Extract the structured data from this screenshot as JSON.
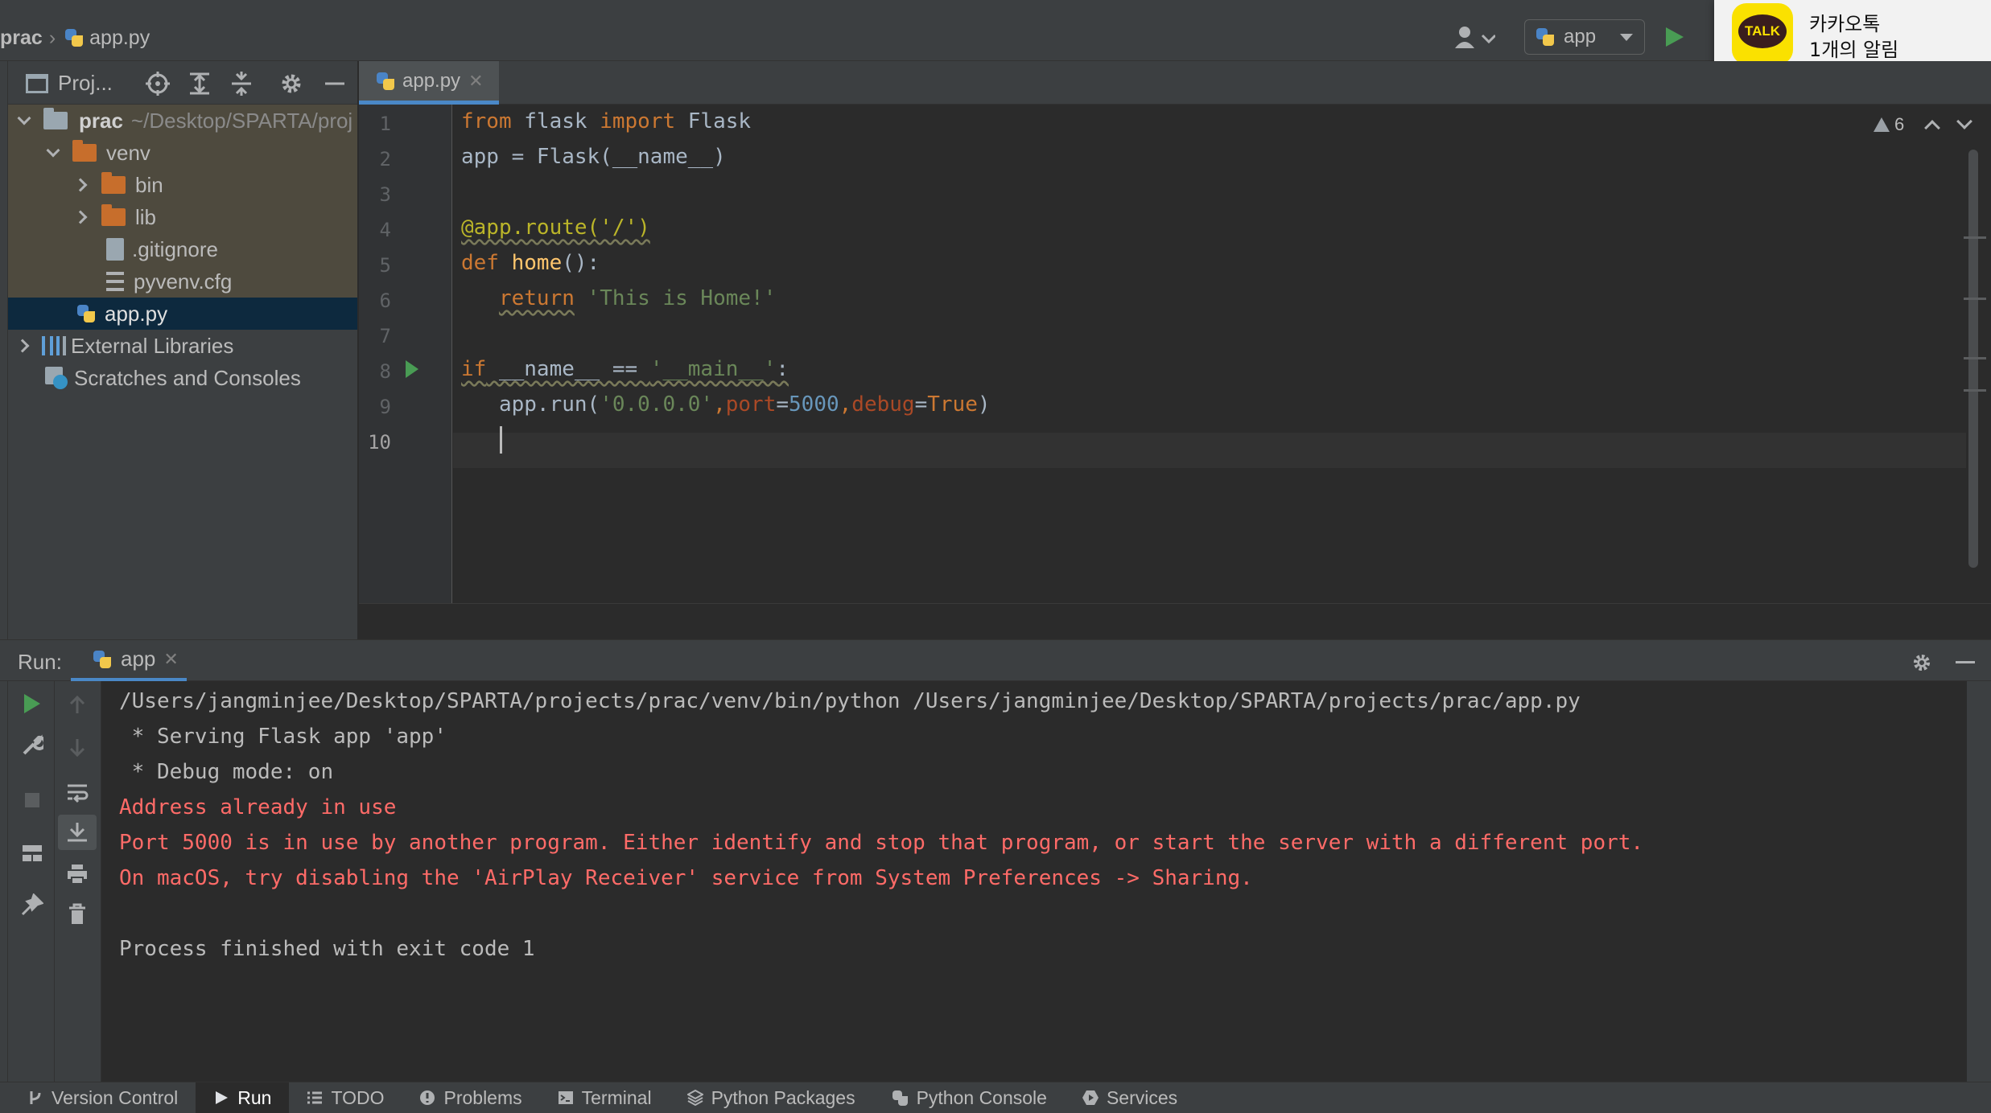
{
  "breadcrumb": {
    "root": "prac",
    "file": "app.py"
  },
  "run_config": {
    "name": "app"
  },
  "notification": {
    "logo_text": "TALK",
    "title": "카카오톡",
    "message": "1개의 알림"
  },
  "project_panel": {
    "title": "Proj...",
    "tree": [
      {
        "label": "prac",
        "path": "~/Desktop/SPARTA/proj",
        "type": "folder",
        "level": 0,
        "expanded": true
      },
      {
        "label": "venv",
        "type": "folder",
        "level": 1,
        "expanded": true
      },
      {
        "label": "bin",
        "type": "folder",
        "level": 2,
        "expanded": false
      },
      {
        "label": "lib",
        "type": "folder",
        "level": 2,
        "expanded": false
      },
      {
        "label": ".gitignore",
        "type": "file",
        "level": 2
      },
      {
        "label": "pyvenv.cfg",
        "type": "config",
        "level": 2
      },
      {
        "label": "app.py",
        "type": "python",
        "level": 1,
        "selected": true
      },
      {
        "label": "External Libraries",
        "type": "library",
        "level": 0
      },
      {
        "label": "Scratches and Consoles",
        "type": "scratch",
        "level": 0
      }
    ]
  },
  "editor": {
    "tab": "app.py",
    "warnings": "6",
    "line_numbers": [
      "1",
      "2",
      "3",
      "4",
      "5",
      "6",
      "7",
      "8",
      "9",
      "10"
    ],
    "code": {
      "l1_from": "from",
      "l1_mod": " flask ",
      "l1_import": "import",
      "l1_name": " Flask",
      "l2": "app = Flask(__name__)",
      "l4": "@app.route('/')",
      "l5_def": "def",
      "l5_fn": " home",
      "l5_rest": "():",
      "l6_indent": "   ",
      "l6_return": "return",
      "l6_str": " 'This is Home!'",
      "l8_if": "if",
      "l8_mid": " __name__ == ",
      "l8_str": "'__main__'",
      "l8_end": ":",
      "l9_a": "   app.run(",
      "l9_str": "'0.0.0.0'",
      "l9_c1": ",",
      "l9_p1": "port",
      "l9_eq1": "=",
      "l9_num": "5000",
      "l9_c2": ",",
      "l9_p2": "debug",
      "l9_eq2": "=",
      "l9_true": "True",
      "l9_end": ")"
    }
  },
  "run_panel": {
    "label": "Run:",
    "tab": "app",
    "lines": [
      {
        "text": "/Users/jangminjee/Desktop/SPARTA/projects/prac/venv/bin/python /Users/jangminjee/Desktop/SPARTA/projects/prac/app.py",
        "kind": "normal"
      },
      {
        "text": " * Serving Flask app 'app'",
        "kind": "normal"
      },
      {
        "text": " * Debug mode: on",
        "kind": "normal"
      },
      {
        "text": "Address already in use",
        "kind": "error"
      },
      {
        "text": "Port 5000 is in use by another program. Either identify and stop that program, or start the server with a different port.",
        "kind": "error"
      },
      {
        "text": "On macOS, try disabling the 'AirPlay Receiver' service from System Preferences -> Sharing.",
        "kind": "error"
      },
      {
        "text": "",
        "kind": "normal"
      },
      {
        "text": "Process finished with exit code 1",
        "kind": "normal"
      }
    ]
  },
  "tool_windows": [
    {
      "label": "Version Control",
      "icon": "branch-icon"
    },
    {
      "label": "Run",
      "icon": "run-icon",
      "active": true
    },
    {
      "label": "TODO",
      "icon": "list-icon"
    },
    {
      "label": "Problems",
      "icon": "problems-icon"
    },
    {
      "label": "Terminal",
      "icon": "terminal-icon"
    },
    {
      "label": "Python Packages",
      "icon": "packages-icon"
    },
    {
      "label": "Python Console",
      "icon": "python-console-icon"
    },
    {
      "label": "Services",
      "icon": "services-icon"
    }
  ],
  "colors": {
    "accent": "#4a88c7",
    "error": "#ff6b68",
    "keyword": "#cc7832",
    "string": "#6a8759",
    "number": "#6897bb",
    "run_green": "#499c54",
    "kakao_yellow": "#fae100"
  }
}
